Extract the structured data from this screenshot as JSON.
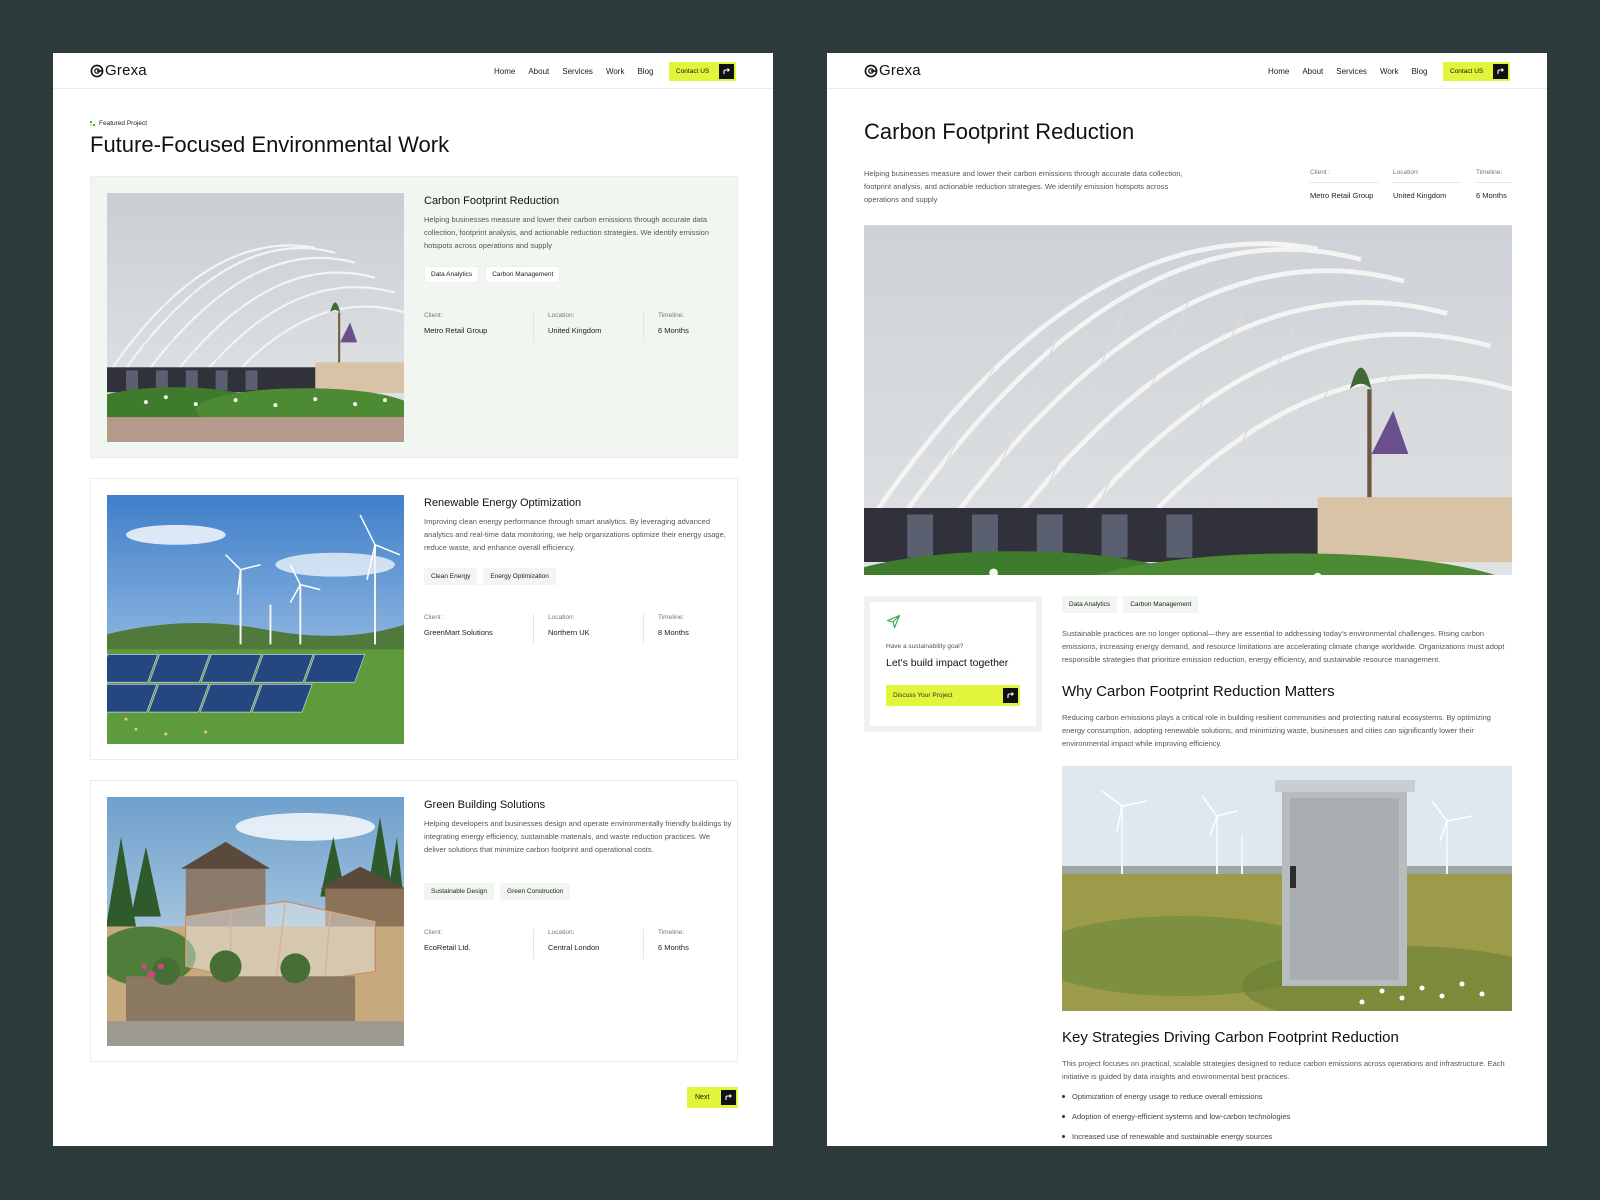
{
  "brand": {
    "name": "Grexa",
    "accent": "#e2f53a",
    "background": "#2c3a3b"
  },
  "nav": {
    "items": [
      "Home",
      "About",
      "Services",
      "Work",
      "Blog"
    ],
    "contact_label": "Contact US"
  },
  "listing": {
    "eyebrow": "Featured Project",
    "title": "Future-Focused Environmental Work",
    "meta_labels": {
      "client": "Client:",
      "location": "Location:",
      "timeline": "Timeline:"
    },
    "projects": [
      {
        "title": "Carbon Footprint Reduction",
        "description": "Helping businesses measure and lower their carbon emissions through accurate data collection, footprint analysis, and actionable reduction strategies. We identify emission hotspots across operations and supply",
        "tags": [
          "Data Analytics",
          "Carbon Management"
        ],
        "client_label": "Client:",
        "client": "Metro Retail Group",
        "location": "United Kingdom",
        "timeline": "6 Months",
        "image": "white-arched-greenhouse-photo"
      },
      {
        "title": "Renewable Energy Optimization",
        "description": "Improving clean energy performance through smart analytics. By leveraging advanced analytics and real-time data monitoring, we help organizations optimize their energy usage, reduce waste, and enhance overall efficiency.",
        "tags": [
          "Clean Energy",
          "Energy Optimization"
        ],
        "client_label": "Client :",
        "client": "GreenMart Solutions",
        "location": "Northern UK",
        "timeline": "8 Months",
        "image": "wind-turbines-solar-panels-photo"
      },
      {
        "title": "Green Building Solutions",
        "description": "Helping developers and businesses design and operate environmentally friendly buildings by integrating energy efficiency, sustainable materials, and waste reduction practices. We deliver solutions that minimize carbon footprint and operational costs.",
        "tags": [
          "Sustainable Design",
          "Green Construction"
        ],
        "client_label": "Client:",
        "client": "EcoRetail Ltd.",
        "location": "Central London",
        "timeline": "6 Months",
        "image": "garden-greenhouse-houses-photo"
      }
    ],
    "next_label": "Next"
  },
  "detail": {
    "title": "Carbon Footprint Reduction",
    "intro": "Helping businesses measure and lower their carbon emissions through accurate data collection, footprint analysis, and actionable reduction strategies. We identify emission hotspots across operations and supply",
    "meta": [
      {
        "label": "Client :",
        "value": "Metro Retail Group"
      },
      {
        "label": "Location:",
        "value": "United Kingdom"
      },
      {
        "label": "Timeline:",
        "value": "6 Months"
      }
    ],
    "tags": [
      "Data Analytics",
      "Carbon Management"
    ],
    "cta": {
      "small": "Have a sustainability goal?",
      "heading": "Let's build impact together",
      "button": "Discuss Your Project"
    },
    "paragraph1": "Sustainable practices are no longer optional—they are essential to addressing today's environmental challenges. Rising carbon emissions, increasing energy demand, and resource limitations are accelerating climate change worldwide. Organizations must adopt responsible strategies that prioritize emission reduction, energy efficiency, and sustainable resource management.",
    "heading2": "Why Carbon Footprint Reduction Matters",
    "paragraph2": "Reducing carbon emissions plays a critical role in building resilient communities and protecting natural ecosystems. By optimizing energy consumption, adopting renewable solutions, and minimizing waste, businesses and cities can significantly lower their environmental impact while improving efficiency.",
    "heading3": "Key Strategies Driving Carbon Footprint Reduction",
    "paragraph3": "This project focuses on practical, scalable strategies designed to reduce carbon emissions across operations and infrastructure. Each initiative is guided by data insights and environmental best practices.",
    "bullets": [
      "Optimization of energy usage to reduce overall emissions",
      "Adoption of energy-efficient systems and low-carbon technologies",
      "Increased use of renewable and sustainable energy sources"
    ]
  }
}
